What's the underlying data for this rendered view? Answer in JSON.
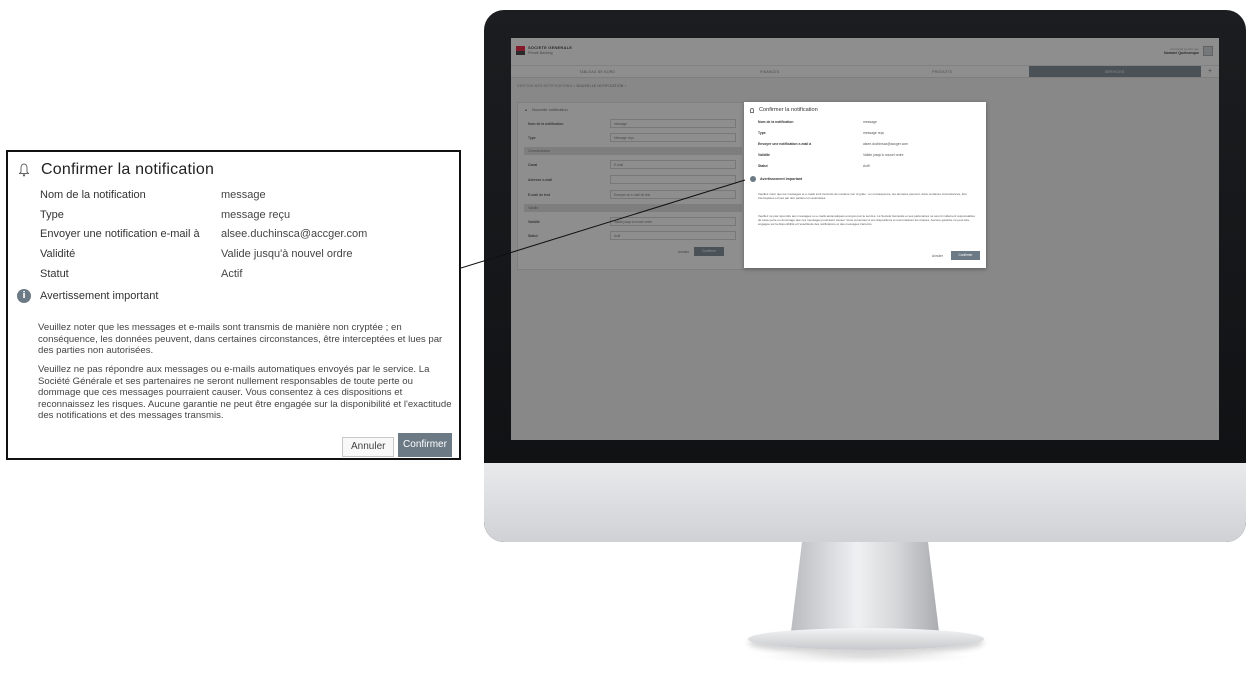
{
  "app": {
    "brand_name": "SOCIETE GENERALE",
    "brand_sub": "Private Banking",
    "user_small": "Connecté en tant que",
    "user_name": "Nommé Quelconque"
  },
  "nav": {
    "tabs": [
      "TABLEAU DE BORD",
      "FINANCES",
      "PRODUITS",
      "SERVICES"
    ],
    "active_index": 3,
    "add_label": "+"
  },
  "breadcrumb": {
    "root": "GESTION DES NOTIFICATIONS",
    "separator": ">",
    "current": "NOUVELLE NOTIFICATION",
    "trail_sep": ">"
  },
  "form": {
    "title": "Nouvelle notification",
    "rows": [
      {
        "label": "Nom de la notification",
        "value": "message"
      },
      {
        "label": "Type",
        "value": "Message reçu"
      }
    ],
    "section_communication": "Communication",
    "canal_label": "Canal",
    "canal_value": "E-mail",
    "adresse_label": "Adresse e-mail",
    "adresse_value": "",
    "email_label": "E-mail de test",
    "email_value": "Envoyer un e-mail de test",
    "section_validite": "Validité",
    "validite_label": "Validité",
    "validite_value": "Valide jusqu'à nouvel ordre",
    "statut_label": "Statut",
    "statut_value": "Actif",
    "cancel": "Annuler",
    "confirm": "Confirmer"
  },
  "modal": {
    "title": "Confirmer la notification",
    "rows": [
      {
        "label": "Nom de la notification",
        "value": "message"
      },
      {
        "label": "Type",
        "value": "message reçu"
      },
      {
        "label": "Envoyer une notification e-mail à",
        "value": "alsee.duchinsca@accger.com"
      },
      {
        "label": "Validité",
        "value": "Valide jusqu'à nouvel ordre"
      },
      {
        "label": "Statut",
        "value": "Actif"
      }
    ],
    "warning_title": "Avertissement important",
    "paragraph_1": "Veuillez noter que les messages et e-mails sont transmis de manière non cryptée ; en conséquence, les données peuvent, dans certaines circonstances, être interceptées et lues par des parties non autorisées.",
    "paragraph_2": "Veuillez ne pas répondre aux messages ou e-mails automatiques envoyés par le service. La Société Générale et ses partenaires ne seront nullement responsables de toute perte ou dommage que ces messages pourraient causer. Vous consentez à ces dispositions et reconnaissez les risques. Aucune garantie ne peut être engagée sur la disponibilité et l'exactitude des notifications et des messages transmis.",
    "cancel": "Annuler",
    "confirm": "Confirmer"
  }
}
